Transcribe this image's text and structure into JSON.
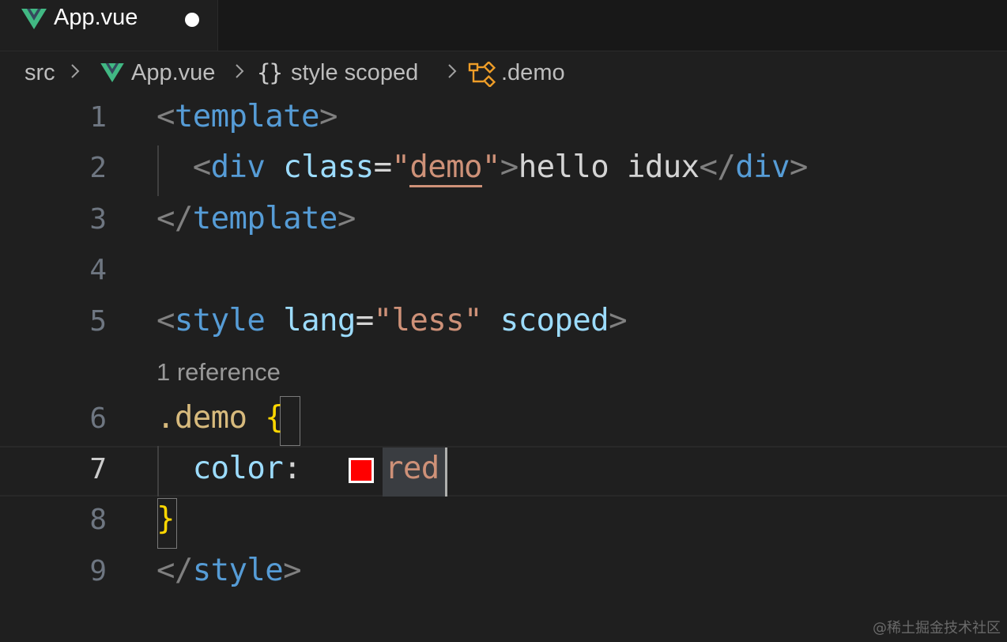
{
  "tab": {
    "title": "App.vue",
    "dirty": true,
    "icon": "vue-icon"
  },
  "breadcrumb": {
    "folder": "src",
    "file": "App.vue",
    "braces": "{}",
    "symbol": "style scoped",
    "selector": ".demo"
  },
  "editor": {
    "line_numbers": [
      "1",
      "2",
      "3",
      "4",
      "5",
      "6",
      "7",
      "8",
      "9"
    ],
    "active_line": "7",
    "codelens": "1 reference",
    "lines": {
      "l1": {
        "open": "<",
        "tag": "template",
        "close": ">"
      },
      "l2": {
        "indent": "  ",
        "open": "<",
        "tag": "div",
        "attr": "class",
        "eq": "=",
        "q1": "\"",
        "value": "demo",
        "q2": "\"",
        "close": ">",
        "text": "hello idux",
        "end_open": "</",
        "end_tag": "div",
        "end_close": ">"
      },
      "l3": {
        "open": "</",
        "tag": "template",
        "close": ">"
      },
      "l5": {
        "open": "<",
        "tag": "style",
        "attr1": "lang",
        "eq": "=",
        "value": "\"less\"",
        "attr2": "scoped",
        "close": ">"
      },
      "l6": {
        "selector": ".demo",
        "brace": "{"
      },
      "l7": {
        "indent": "  ",
        "property": "color",
        "colon": ":",
        "value": "red"
      },
      "l8": {
        "brace": "}"
      },
      "l9": {
        "open": "</",
        "tag": "style",
        "close": ">"
      }
    },
    "swatch_color": "#ff0000"
  },
  "watermark": "@稀土掘金技术社区",
  "colors": {
    "background": "#1f1f1f",
    "tag": "#569cd6",
    "attribute": "#9cdcfe",
    "string": "#ce9178",
    "selector": "#d7ba7d",
    "bracket": "#ffd700",
    "vue_green": "#41b883"
  }
}
